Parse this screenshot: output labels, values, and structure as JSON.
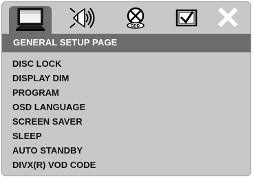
{
  "tabs": [
    {
      "icon": "tv-screen-icon",
      "active": true
    },
    {
      "icon": "speaker-icon",
      "active": false
    },
    {
      "icon": "dolby-disc-icon",
      "active": false
    },
    {
      "icon": "preferences-check-icon",
      "active": false
    },
    {
      "icon": "close-icon",
      "active": false
    }
  ],
  "header": {
    "title": "GENERAL SETUP PAGE"
  },
  "menu": {
    "items": [
      {
        "label": "DISC LOCK"
      },
      {
        "label": "DISPLAY DIM"
      },
      {
        "label": "PROGRAM"
      },
      {
        "label": "OSD LANGUAGE"
      },
      {
        "label": "SCREEN SAVER"
      },
      {
        "label": "SLEEP"
      },
      {
        "label": "AUTO STANDBY"
      },
      {
        "label": "DIVX(R) VOD CODE"
      }
    ]
  },
  "colors": {
    "panel": "#c8c8c8",
    "header": "#6d6d6d",
    "text": "#111111",
    "header_text": "#ffffff"
  }
}
